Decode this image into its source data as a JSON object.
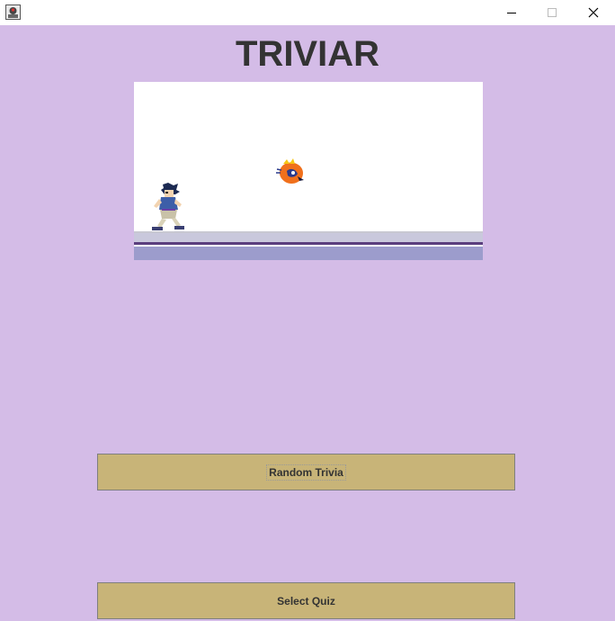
{
  "window": {
    "controls": [
      "minimize-icon",
      "maximize-icon",
      "close-icon"
    ]
  },
  "app": {
    "title": "TRIVIAR"
  },
  "game": {
    "sprites": [
      "player-character",
      "enemy-character"
    ]
  },
  "buttons": {
    "random_trivia": "Random Trivia",
    "select_quiz": "Select Quiz"
  },
  "colors": {
    "background": "#d4bce7",
    "button": "#c8b478",
    "title_text": "#333333",
    "floor_base": "#9c9ccc",
    "floor_dark": "#5b3f7e"
  }
}
